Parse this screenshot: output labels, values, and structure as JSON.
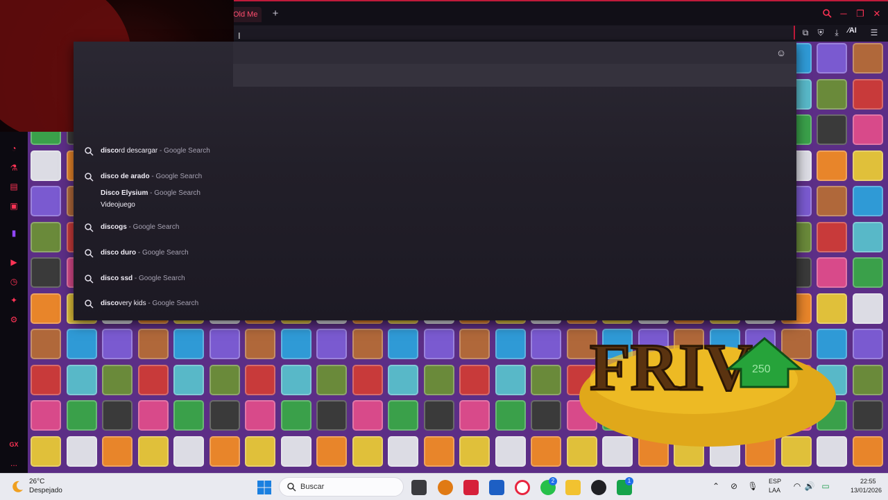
{
  "browser": {
    "active_tab_title": "Old Me",
    "new_tab_symbol": "+",
    "ai_label": "AI",
    "accent_color": "#c01a3a"
  },
  "omnibox": {
    "suggestions": [
      {
        "match": "disco",
        "rest": "rd descargar",
        "source": " - Google Search",
        "icon": "search-icon"
      },
      {
        "match": "disco",
        "rest": " de arado",
        "source": " - Google Search",
        "icon": "search-icon"
      },
      {
        "match": "Disco Elysium",
        "rest": "",
        "source": " - Google Search",
        "subtitle": "Videojuego",
        "icon": "none"
      },
      {
        "match": "disco",
        "rest": "gs",
        "source": " - Google Search",
        "icon": "search-icon"
      },
      {
        "match": "disco",
        "rest": " duro",
        "source": " - Google Search",
        "icon": "search-icon"
      },
      {
        "match": "disco",
        "rest": " ssd",
        "source": " - Google Search",
        "icon": "search-icon"
      },
      {
        "match": "disco",
        "rest": "very kids",
        "source": " - Google Search",
        "icon": "search-icon"
      }
    ]
  },
  "sidebar": {
    "gx_label": "GX",
    "more_label": "..."
  },
  "promo": {
    "text": "FRIV",
    "badge": "250"
  },
  "taskbar": {
    "weather_temp": "26°C",
    "weather_desc": "Despejado",
    "search_label": "Buscar",
    "whatsapp_badge": "2",
    "xbox_badge": "1",
    "lang_line1": "ESP",
    "lang_line2": "LAA",
    "time": "22:55",
    "date": "13/01/2026"
  }
}
